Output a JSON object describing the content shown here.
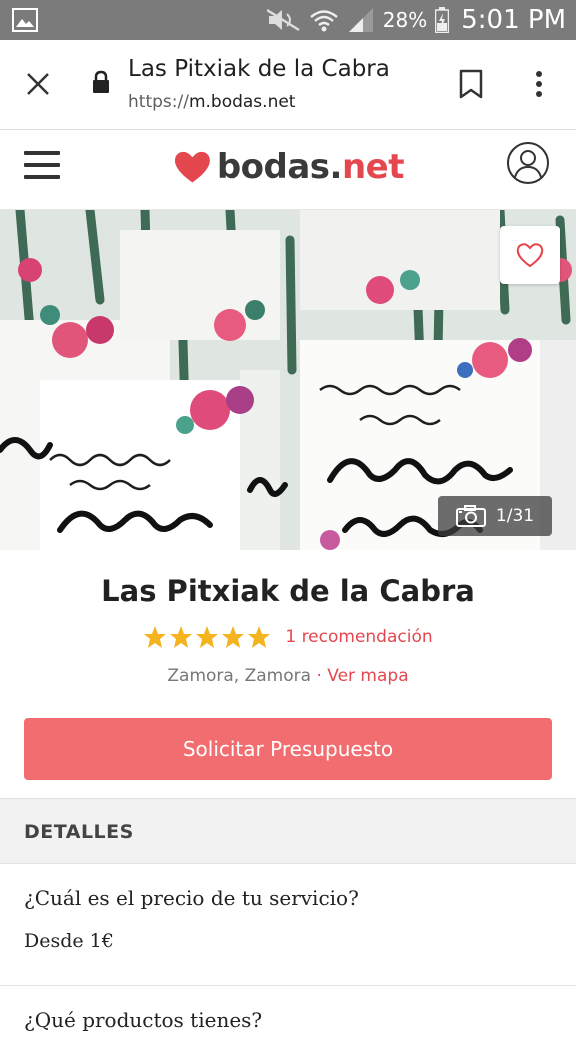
{
  "status_bar": {
    "battery_percent": "28%",
    "time": "5:01 PM",
    "icons": [
      "image-icon",
      "mute-icon",
      "wifi-icon",
      "signal-icon",
      "battery-charging-icon"
    ]
  },
  "browser": {
    "page_title": "Las Pitxiak de la Cabra",
    "url_scheme": "https://",
    "url_host": "m.bodas.net",
    "icons": [
      "close-icon",
      "lock-icon",
      "bookmark-icon",
      "more-vert-icon"
    ]
  },
  "site_header": {
    "logo_main": "bodas.",
    "logo_accent": "net",
    "brand_color": "#e5474f",
    "icons": [
      "hamburger-menu-icon",
      "logo-heart-icon",
      "user-avatar-icon"
    ]
  },
  "hero": {
    "photo_counter": "1/31",
    "icons": [
      "heart-outline-icon",
      "camera-icon"
    ]
  },
  "vendor": {
    "name": "Las Pitxiak de la Cabra",
    "rating_stars": 5,
    "recommendations": "1 recomendación",
    "location": "Zamora, Zamora",
    "separator": " · ",
    "map_link": "Ver mapa",
    "cta_label": "Solicitar Presupuesto",
    "cta_color": "#f26d6f"
  },
  "details": {
    "title": "DETALLES",
    "items": [
      {
        "question": "¿Cuál es el precio de tu servicio?",
        "answer": "Desde 1€"
      },
      {
        "question": "¿Qué productos tienes?",
        "answer": ""
      }
    ]
  }
}
